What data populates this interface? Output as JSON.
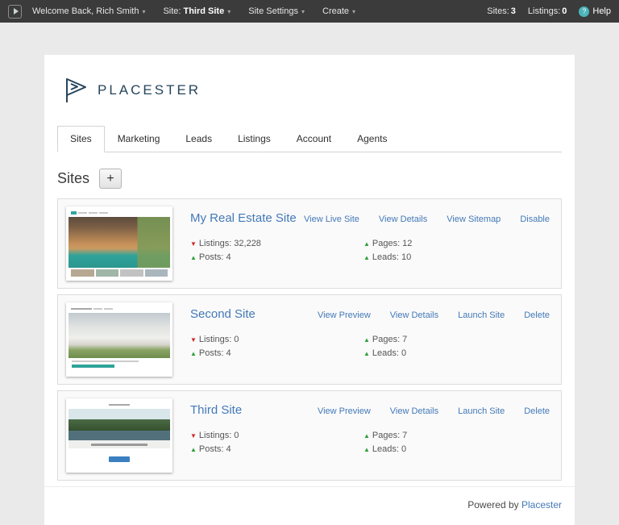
{
  "topbar": {
    "menus": [
      {
        "label": "Welcome Back, Rich Smith"
      },
      {
        "prefix": "Site:",
        "bold": "Third Site"
      },
      {
        "label": "Site Settings"
      },
      {
        "label": "Create"
      }
    ],
    "counters": {
      "sites_label": "Sites:",
      "sites_value": "3",
      "listings_label": "Listings:",
      "listings_value": "0"
    },
    "help_label": "Help"
  },
  "icons": {
    "caret": "▾",
    "help": "?"
  },
  "brand": {
    "name": "PLACESTER"
  },
  "tabs": [
    {
      "label": "Sites",
      "active": true
    },
    {
      "label": "Marketing",
      "active": false
    },
    {
      "label": "Leads",
      "active": false
    },
    {
      "label": "Listings",
      "active": false
    },
    {
      "label": "Account",
      "active": false
    },
    {
      "label": "Agents",
      "active": false
    }
  ],
  "page": {
    "title": "Sites",
    "add_button": "+"
  },
  "sites": [
    {
      "name": "My Real Estate Site",
      "stats": [
        {
          "dir": "down",
          "arrow": "▼",
          "label": "Listings:",
          "value": "32,228"
        },
        {
          "dir": "up",
          "arrow": "▲",
          "label": "Posts:",
          "value": "4"
        },
        {
          "dir": "up",
          "arrow": "▲",
          "label": "Pages:",
          "value": "12"
        },
        {
          "dir": "up",
          "arrow": "▲",
          "label": "Leads:",
          "value": "10"
        }
      ],
      "actions": [
        "View Live Site",
        "View Details",
        "View Sitemap",
        "Disable"
      ]
    },
    {
      "name": "Second Site",
      "stats": [
        {
          "dir": "down",
          "arrow": "▼",
          "label": "Listings:",
          "value": "0"
        },
        {
          "dir": "up",
          "arrow": "▲",
          "label": "Posts:",
          "value": "4"
        },
        {
          "dir": "up",
          "arrow": "▲",
          "label": "Pages:",
          "value": "7"
        },
        {
          "dir": "up",
          "arrow": "▲",
          "label": "Leads:",
          "value": "0"
        }
      ],
      "actions": [
        "View Preview",
        "View Details",
        "Launch Site",
        "Delete"
      ]
    },
    {
      "name": "Third Site",
      "stats": [
        {
          "dir": "down",
          "arrow": "▼",
          "label": "Listings:",
          "value": "0"
        },
        {
          "dir": "up",
          "arrow": "▲",
          "label": "Posts:",
          "value": "4"
        },
        {
          "dir": "up",
          "arrow": "▲",
          "label": "Pages:",
          "value": "7"
        },
        {
          "dir": "up",
          "arrow": "▲",
          "label": "Leads:",
          "value": "0"
        }
      ],
      "actions": [
        "View Preview",
        "View Details",
        "Launch Site",
        "Delete"
      ]
    }
  ],
  "footer": {
    "powered_by": "Powered by",
    "brand_link": "Placester"
  },
  "colors": {
    "topbar_bg": "#3b3b3b",
    "page_bg": "#eaeaea",
    "link_blue": "#4379b8",
    "trend_up": "#2e9e3e",
    "trend_down": "#cc2b2b",
    "brand_navy": "#26455c",
    "help_teal": "#4db3ba"
  }
}
